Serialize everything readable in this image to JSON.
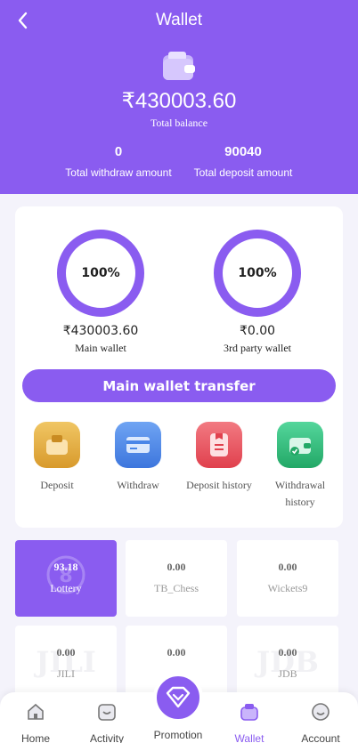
{
  "header": {
    "title": "Wallet",
    "balance": "₹430003.60",
    "balance_label": "Total balance",
    "withdraw_amount": "0",
    "withdraw_label": "Total withdraw amount",
    "deposit_amount": "90040",
    "deposit_label": "Total deposit amount"
  },
  "wallets": {
    "main": {
      "percent": "100%",
      "amount": "₹430003.60",
      "label": "Main wallet"
    },
    "third_party": {
      "percent": "100%",
      "amount": "₹0.00",
      "label": "3rd party wallet"
    }
  },
  "transfer_button": "Main wallet transfer",
  "actions": [
    {
      "label": "Deposit",
      "icon": "deposit-icon",
      "color": "#e0a93c"
    },
    {
      "label": "Withdraw",
      "icon": "withdraw-icon",
      "color": "#4a86e8"
    },
    {
      "label": "Deposit history",
      "icon": "deposit-history-icon",
      "color": "#e8505b"
    },
    {
      "label": "Withdrawal history",
      "icon": "withdrawal-history-icon",
      "color": "#2ec27e"
    }
  ],
  "games": [
    {
      "amount": "93.18",
      "name": "Lottery",
      "active": true
    },
    {
      "amount": "0.00",
      "name": "TB_Chess"
    },
    {
      "amount": "0.00",
      "name": "Wickets9"
    },
    {
      "amount": "0.00",
      "name": "JILI",
      "watermark": "JILI"
    },
    {
      "amount": "0.00",
      "name": ""
    },
    {
      "amount": "0.00",
      "name": "JDB",
      "watermark": "JDB"
    }
  ],
  "tabs": [
    {
      "label": "Home",
      "icon": "home-icon"
    },
    {
      "label": "Activity",
      "icon": "activity-icon"
    },
    {
      "label": "Promotion",
      "icon": "diamond-icon"
    },
    {
      "label": "Wallet",
      "icon": "wallet-icon",
      "active": true
    },
    {
      "label": "Account",
      "icon": "account-icon"
    }
  ],
  "colors": {
    "primary": "#8a5cf0",
    "background": "#f4f3fb"
  }
}
